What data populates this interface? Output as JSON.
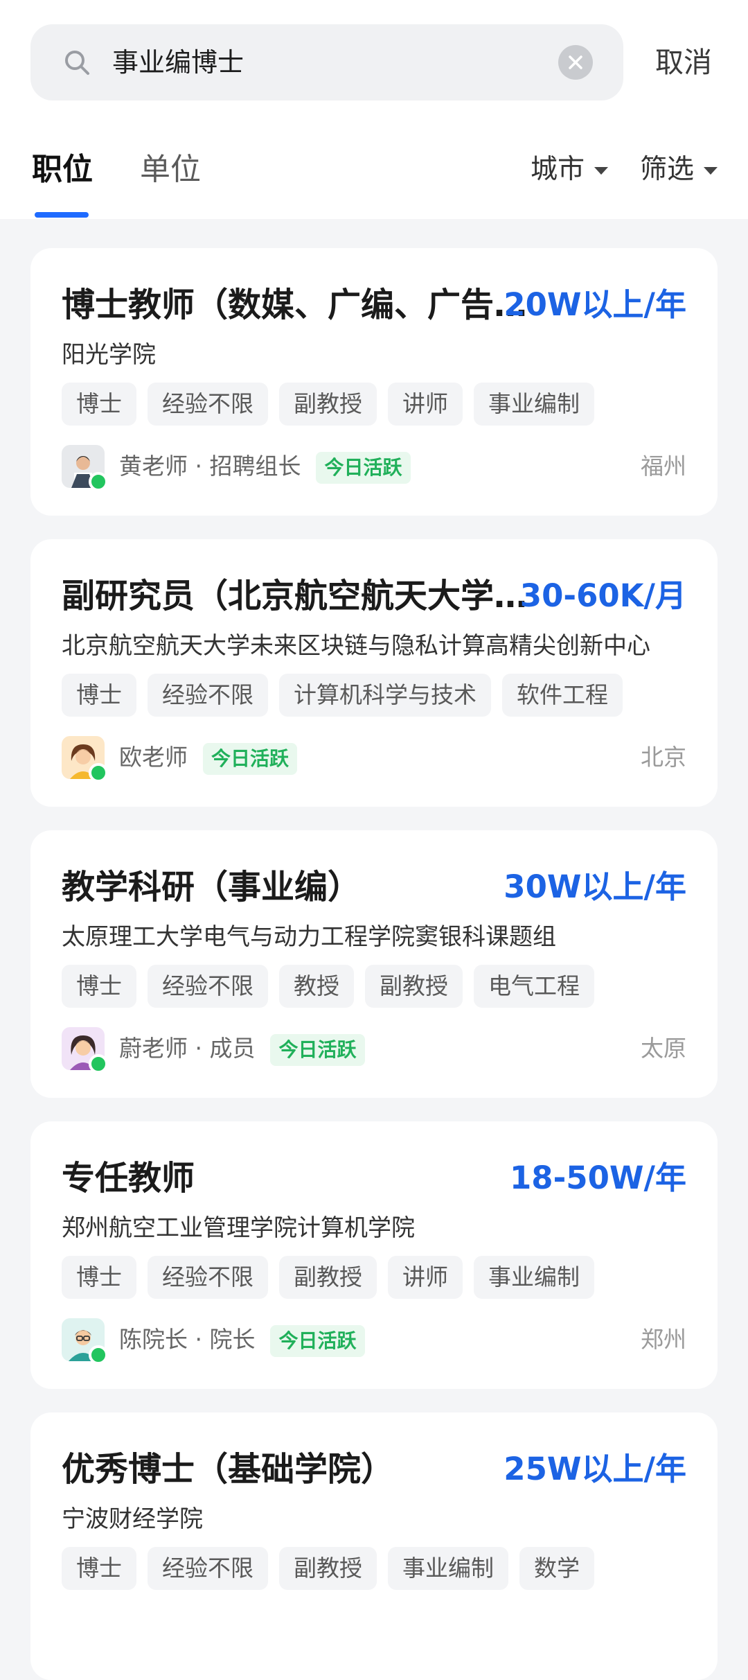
{
  "search": {
    "query": "事业编博士",
    "cancel_label": "取消"
  },
  "tabs": [
    {
      "label": "职位",
      "active": true
    },
    {
      "label": "单位",
      "active": false
    }
  ],
  "filters": {
    "city_label": "城市",
    "filter_label": "筛选"
  },
  "colors": {
    "accent": "#1f6bff",
    "salary": "#1c63e4",
    "active_green": "#20b05a"
  },
  "jobs": [
    {
      "title": "博士教师（数媒、广编、广告、动画等）",
      "salary": "20W以上/年",
      "company": "阳光学院",
      "tags": [
        "博士",
        "经验不限",
        "副教授",
        "讲师",
        "事业编制"
      ],
      "recruiter": "黄老师 · 招聘组长",
      "active_label": "今日活跃",
      "city": "福州",
      "avatar_icon": "man-with-glasses-avatar-icon"
    },
    {
      "title": "副研究员（北京航空航天大学未来区块链）",
      "salary": "30-60K/月",
      "company": "北京航空航天大学未来区块链与隐私计算高精尖创新中心",
      "tags": [
        "博士",
        "经验不限",
        "计算机科学与技术",
        "软件工程"
      ],
      "recruiter": "欧老师",
      "active_label": "今日活跃",
      "city": "北京",
      "avatar_icon": "woman-cartoon-avatar-icon"
    },
    {
      "title": "教学科研（事业编）",
      "salary": "30W以上/年",
      "company": "太原理工大学电气与动力工程学院窦银科课题组",
      "tags": [
        "博士",
        "经验不限",
        "教授",
        "副教授",
        "电气工程"
      ],
      "recruiter": "蔚老师 · 成员",
      "active_label": "今日活跃",
      "city": "太原",
      "avatar_icon": "woman-purple-avatar-icon"
    },
    {
      "title": "专任教师",
      "salary": "18-50W/年",
      "company": "郑州航空工业管理学院计算机学院",
      "tags": [
        "博士",
        "经验不限",
        "副教授",
        "讲师",
        "事业编制"
      ],
      "recruiter": "陈院长 · 院长",
      "active_label": "今日活跃",
      "city": "郑州",
      "avatar_icon": "man-glasses-teal-avatar-icon"
    },
    {
      "title": "优秀博士（基础学院）",
      "salary": "25W以上/年",
      "company": "宁波财经学院",
      "tags": [
        "博士",
        "经验不限",
        "副教授",
        "事业编制",
        "数学"
      ],
      "recruiter": "",
      "active_label": "",
      "city": "",
      "avatar_icon": ""
    }
  ]
}
